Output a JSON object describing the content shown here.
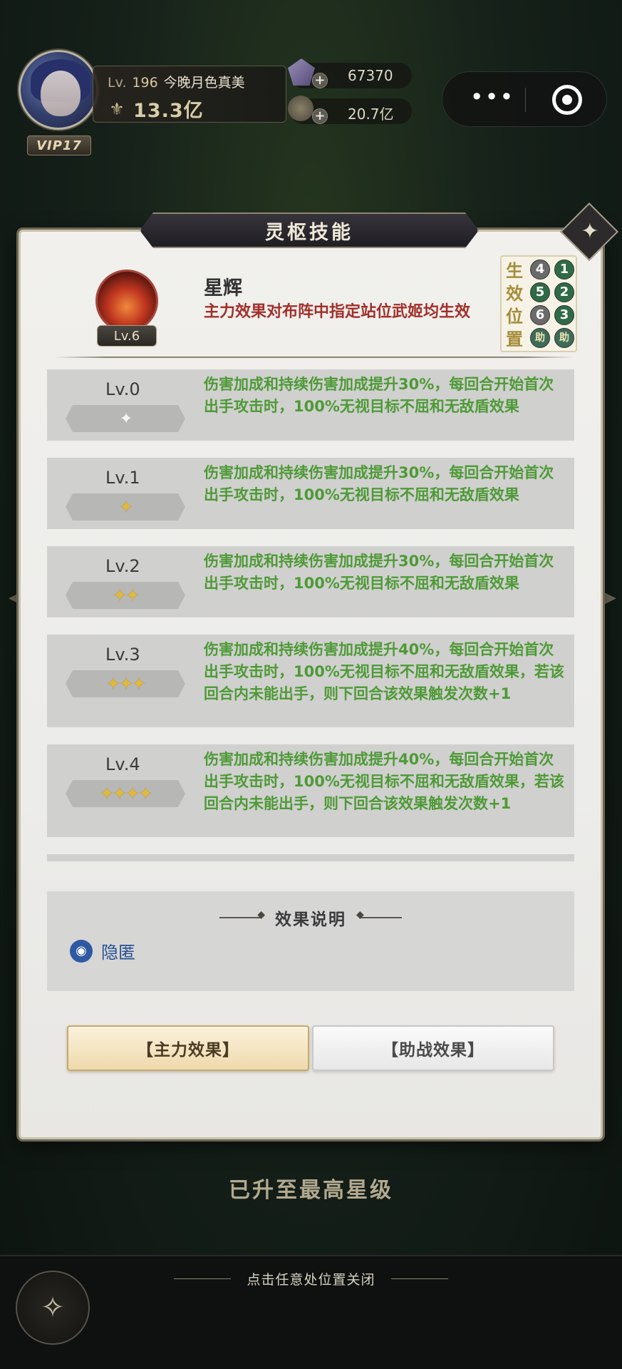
{
  "player": {
    "lv_prefix": "Lv.",
    "level": "196",
    "name": "今晚月色真美",
    "power": "13.3亿",
    "vip": "VIP17"
  },
  "resources": [
    {
      "icon": "gem-icon",
      "value": "67370"
    },
    {
      "icon": "coin-icon",
      "value": "20.7亿"
    }
  ],
  "panel": {
    "title": "灵枢技能"
  },
  "skill": {
    "name": "星辉",
    "level_badge": "Lv.6",
    "description": "主力效果对布阵中指定站位武姬均生效",
    "position_label": [
      "生",
      "效",
      "位",
      "置"
    ],
    "positions": [
      [
        "4",
        "1"
      ],
      [
        "5",
        "2"
      ],
      [
        "6",
        "3"
      ],
      [
        "助",
        "助"
      ]
    ]
  },
  "levels": [
    {
      "label": "Lv.0",
      "stars": "✦",
      "filled": false,
      "text": "伤害加成和持续伤害加成提升30%，每回合开始首次出手攻击时，100%无视目标不屈和无敌盾效果"
    },
    {
      "label": "Lv.1",
      "stars": "✦",
      "filled": true,
      "text": "伤害加成和持续伤害加成提升30%，每回合开始首次出手攻击时，100%无视目标不屈和无敌盾效果"
    },
    {
      "label": "Lv.2",
      "stars": "✦✦",
      "filled": true,
      "text": "伤害加成和持续伤害加成提升30%，每回合开始首次出手攻击时，100%无视目标不屈和无敌盾效果"
    },
    {
      "label": "Lv.3",
      "stars": "✦✦✦",
      "filled": true,
      "text": "伤害加成和持续伤害加成提升40%，每回合开始首次出手攻击时，100%无视目标不屈和无敌盾效果，若该回合内未能出手，则下回合该效果触发次数+1"
    },
    {
      "label": "Lv.4",
      "stars": "✦✦✦✦",
      "filled": true,
      "text": "伤害加成和持续伤害加成提升40%，每回合开始首次出手攻击时，100%无视目标不屈和无敌盾效果，若该回合内未能出手，则下回合该效果触发次数+1"
    }
  ],
  "effect": {
    "title": "效果说明",
    "item_name": "隐匿"
  },
  "tabs": {
    "main": "【主力效果】",
    "support": "【助战效果】"
  },
  "status": "已升至最高星级",
  "close_hint": "点击任意处位置关闭"
}
